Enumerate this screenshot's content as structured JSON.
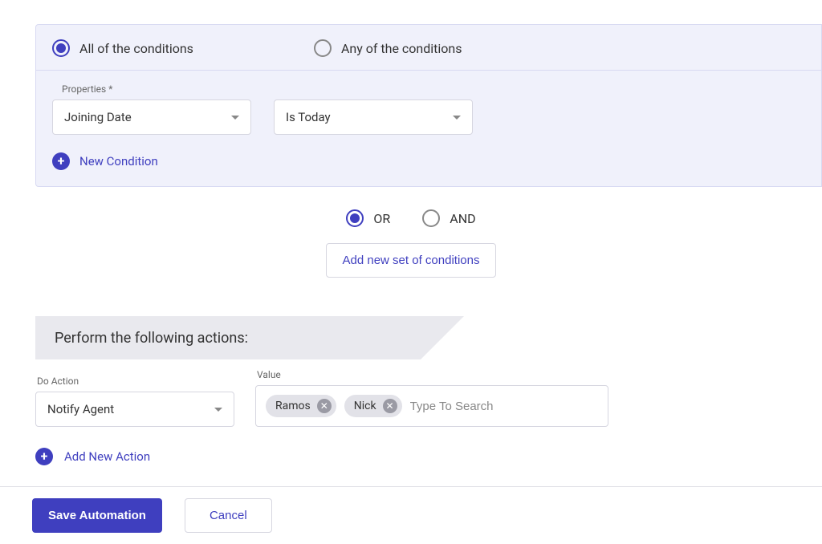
{
  "conditions": {
    "match_mode": {
      "all_label": "All of the conditions",
      "any_label": "Any of the conditions",
      "selected": "all"
    },
    "properties_label": "Properties *",
    "property_select": "Joining Date",
    "operator_select": "Is Today",
    "new_condition_label": "New Condition"
  },
  "set_logic": {
    "or_label": "OR",
    "and_label": "AND",
    "selected": "or",
    "add_set_label": "Add new set of conditions"
  },
  "actions": {
    "header": "Perform the following actions:",
    "do_action_label": "Do Action",
    "do_action_value": "Notify Agent",
    "value_label": "Value",
    "tags": [
      "Ramos",
      "Nick"
    ],
    "search_placeholder": "Type To Search",
    "add_action_label": "Add New Action"
  },
  "footer": {
    "save_label": "Save Automation",
    "cancel_label": "Cancel"
  }
}
